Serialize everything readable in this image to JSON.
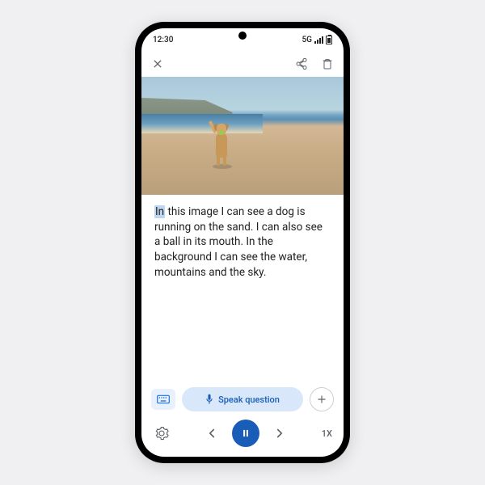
{
  "status": {
    "time": "12:30",
    "network": "5G"
  },
  "description": {
    "highlighted": "In",
    "rest": " this image I can see a dog is running on the sand. I can also see a ball in its mouth. In the background I can see the water, mountains and the sky."
  },
  "input": {
    "speak_label": "Speak question"
  },
  "controls": {
    "speed": "1X"
  }
}
